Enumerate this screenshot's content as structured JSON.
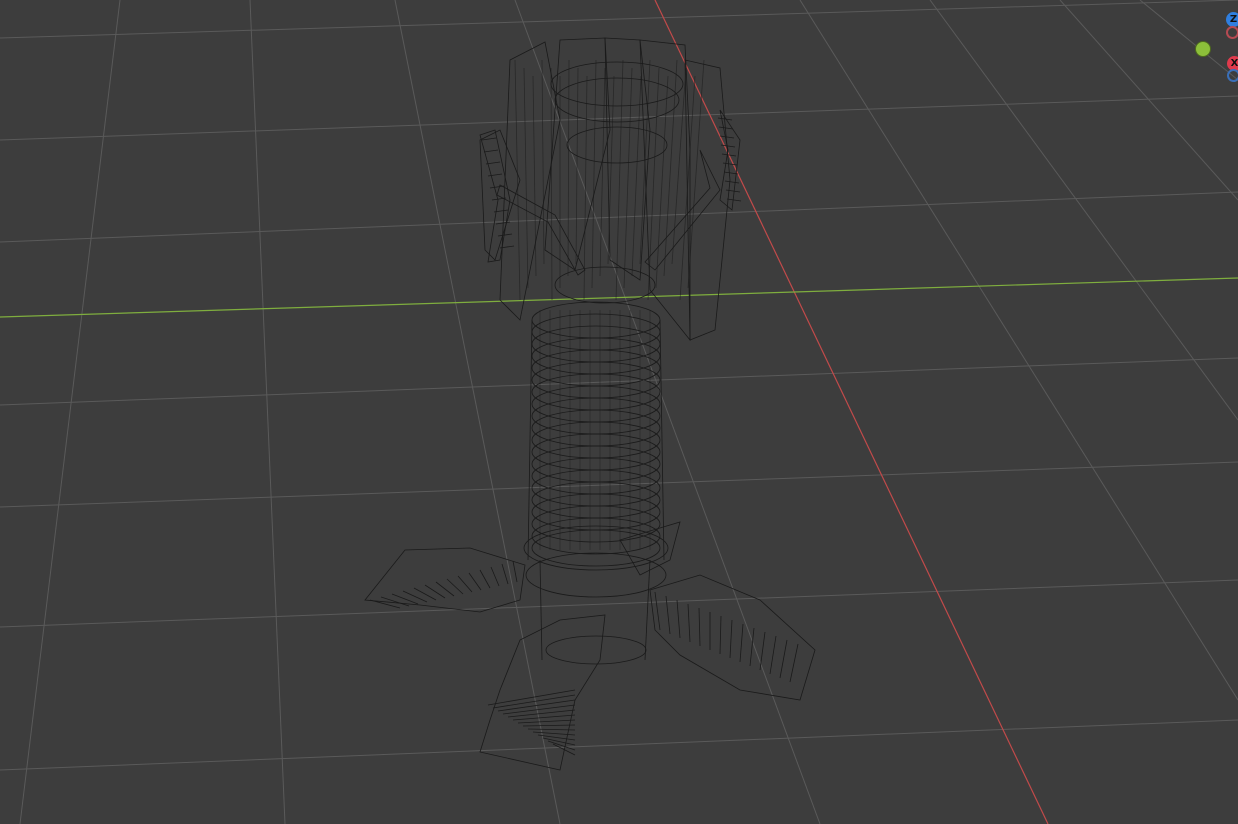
{
  "viewport": {
    "background": "#3d3d3d",
    "grid_color": "#5a5a5a",
    "x_axis_color": "#c14a4a",
    "y_axis_color": "#7fae3e",
    "wire_color": "#1a1a1a"
  },
  "gizmo": {
    "z_label": "Z",
    "x_label": "X",
    "z_color": "#2f7fe0",
    "x_color": "#e03a4c",
    "y_color": "#8cbf3a"
  },
  "object": {
    "icon": "wireframe-tower-mesh"
  }
}
